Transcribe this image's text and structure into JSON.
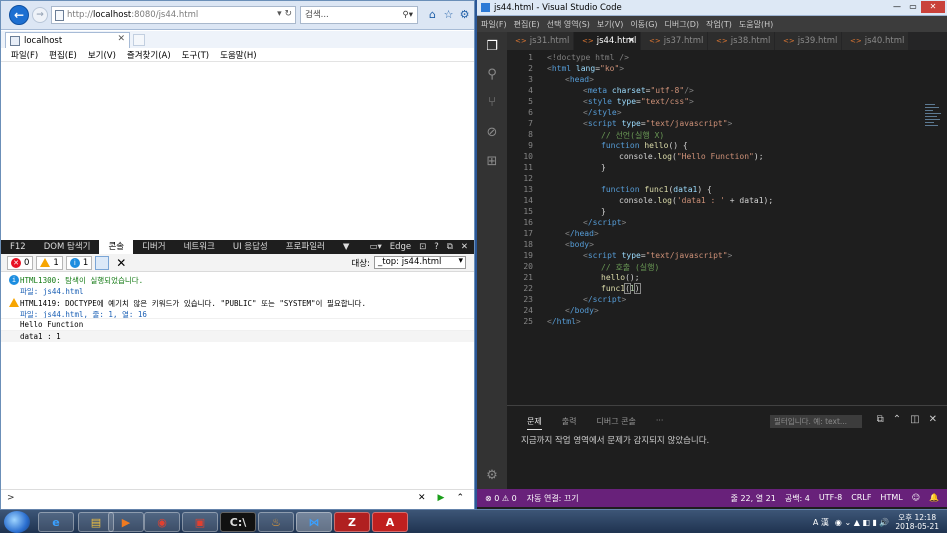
{
  "ie": {
    "url_prefix": "http://",
    "url_host": "localhost",
    "url_rest": ":8080/js44.html",
    "search_placeholder": "검색...",
    "tab_title": "localhost",
    "menu": [
      "파일(F)",
      "편집(E)",
      "보기(V)",
      "즐겨찾기(A)",
      "도구(T)",
      "도움말(H)"
    ],
    "f12": {
      "label": "F12",
      "tabs": [
        "DOM 탐색기",
        "콘솔",
        "디버거",
        "네트워크",
        "UI 응답성",
        "프로파일러"
      ],
      "active_tab": "콘솔",
      "emulation": "Edge",
      "error_count": "0",
      "warning_count": "1",
      "info_count": "1",
      "target_label": "대상:",
      "target_value": "_top: js44.html",
      "messages": [
        {
          "type": "info",
          "text": "HTML1300: 탐색이 실행되었습니다.",
          "source": "파일: js44.html"
        },
        {
          "type": "warning",
          "text": "HTML1419: DOCTYPE에 예기치 않은 키워드가 있습니다. \"PUBLIC\" 또는 \"SYSTEM\"이 필요합니다.",
          "source": "파일: js44.html, 줄: 1, 열: 16"
        }
      ],
      "outputs": [
        "Hello Function",
        "data1 : 1"
      ],
      "prompt": ">"
    }
  },
  "vscode": {
    "title": "js44.html - Visual Studio Code",
    "menu": [
      "파일(F)",
      "편집(E)",
      "선택 영역(S)",
      "보기(V)",
      "이동(G)",
      "디버그(D)",
      "작업(T)",
      "도움말(H)"
    ],
    "tabs": [
      {
        "label": "js31.html",
        "active": false
      },
      {
        "label": "js44.html",
        "active": true
      },
      {
        "label": "js37.html",
        "active": false
      },
      {
        "label": "js38.html",
        "active": false
      },
      {
        "label": "js39.html",
        "active": false
      },
      {
        "label": "js40.html",
        "active": false
      }
    ],
    "line_numbers": [
      "1",
      "2",
      "3",
      "4",
      "5",
      "6",
      "7",
      "8",
      "9",
      "10",
      "11",
      "12",
      "13",
      "14",
      "15",
      "16",
      "17",
      "18",
      "19",
      "20",
      "21",
      "22",
      "23",
      "24",
      "25"
    ],
    "code": {
      "l1": "<!doctype html />",
      "l2_tag": "html",
      "l2_attr": "lang",
      "l2_val": "\"ko\"",
      "l3": "head",
      "l4_tag": "meta",
      "l4_attr": "charset",
      "l4_val": "\"utf-8\"",
      "l5_tag": "style",
      "l5_attr": "type",
      "l5_val": "\"text/css\"",
      "l6": "/style",
      "l7_tag": "script",
      "l7_attr": "type",
      "l7_val": "\"text/javascript\"",
      "l8": "// 선언(실행 X)",
      "l9_kw": "function",
      "l9_fn": "hello",
      "l9_rest": "() {",
      "l10_obj": "console.",
      "l10_fn": "log",
      "l10_str": "\"Hello Function\"",
      "l10_end": ");",
      "l11": "}",
      "l13_kw": "function",
      "l13_fn": "func1",
      "l13_param": "data1",
      "l13_end": ") {",
      "l14_obj": "console.",
      "l14_fn": "log",
      "l14_str": "'data1 : '",
      "l14_rest": " + data1);",
      "l15": "}",
      "l16": "/script",
      "l17": "/head",
      "l18": "body",
      "l19_tag": "script",
      "l19_attr": "type",
      "l19_val": "\"text/javascript\"",
      "l20": "// 호출 (실행)",
      "l21_fn": "hello",
      "l21_rest": "();",
      "l22_fn": "func1",
      "l22_num": "1",
      "l23": "/script",
      "l24": "/body",
      "l25": "/html"
    },
    "panel": {
      "tabs": [
        "문제",
        "출력",
        "디버그 콘솔",
        "···"
      ],
      "filter_placeholder": "필터입니다. 예: text...",
      "message": "지금까지 작업 영역에서 문제가 감지되지 않았습니다."
    },
    "status": {
      "errors": "0",
      "warnings": "0",
      "autoconnect": "자동 연결: 끄기",
      "position": "줄 22, 열 21",
      "spaces": "공백: 4",
      "encoding": "UTF-8",
      "eol": "CRLF",
      "language": "HTML"
    }
  },
  "taskbar": {
    "ime": "A 漢",
    "time": "오후 12:18",
    "date": "2018-05-21"
  },
  "colors": {
    "vs_status": "#68217a",
    "ie_accent": "#1c6fd1"
  }
}
